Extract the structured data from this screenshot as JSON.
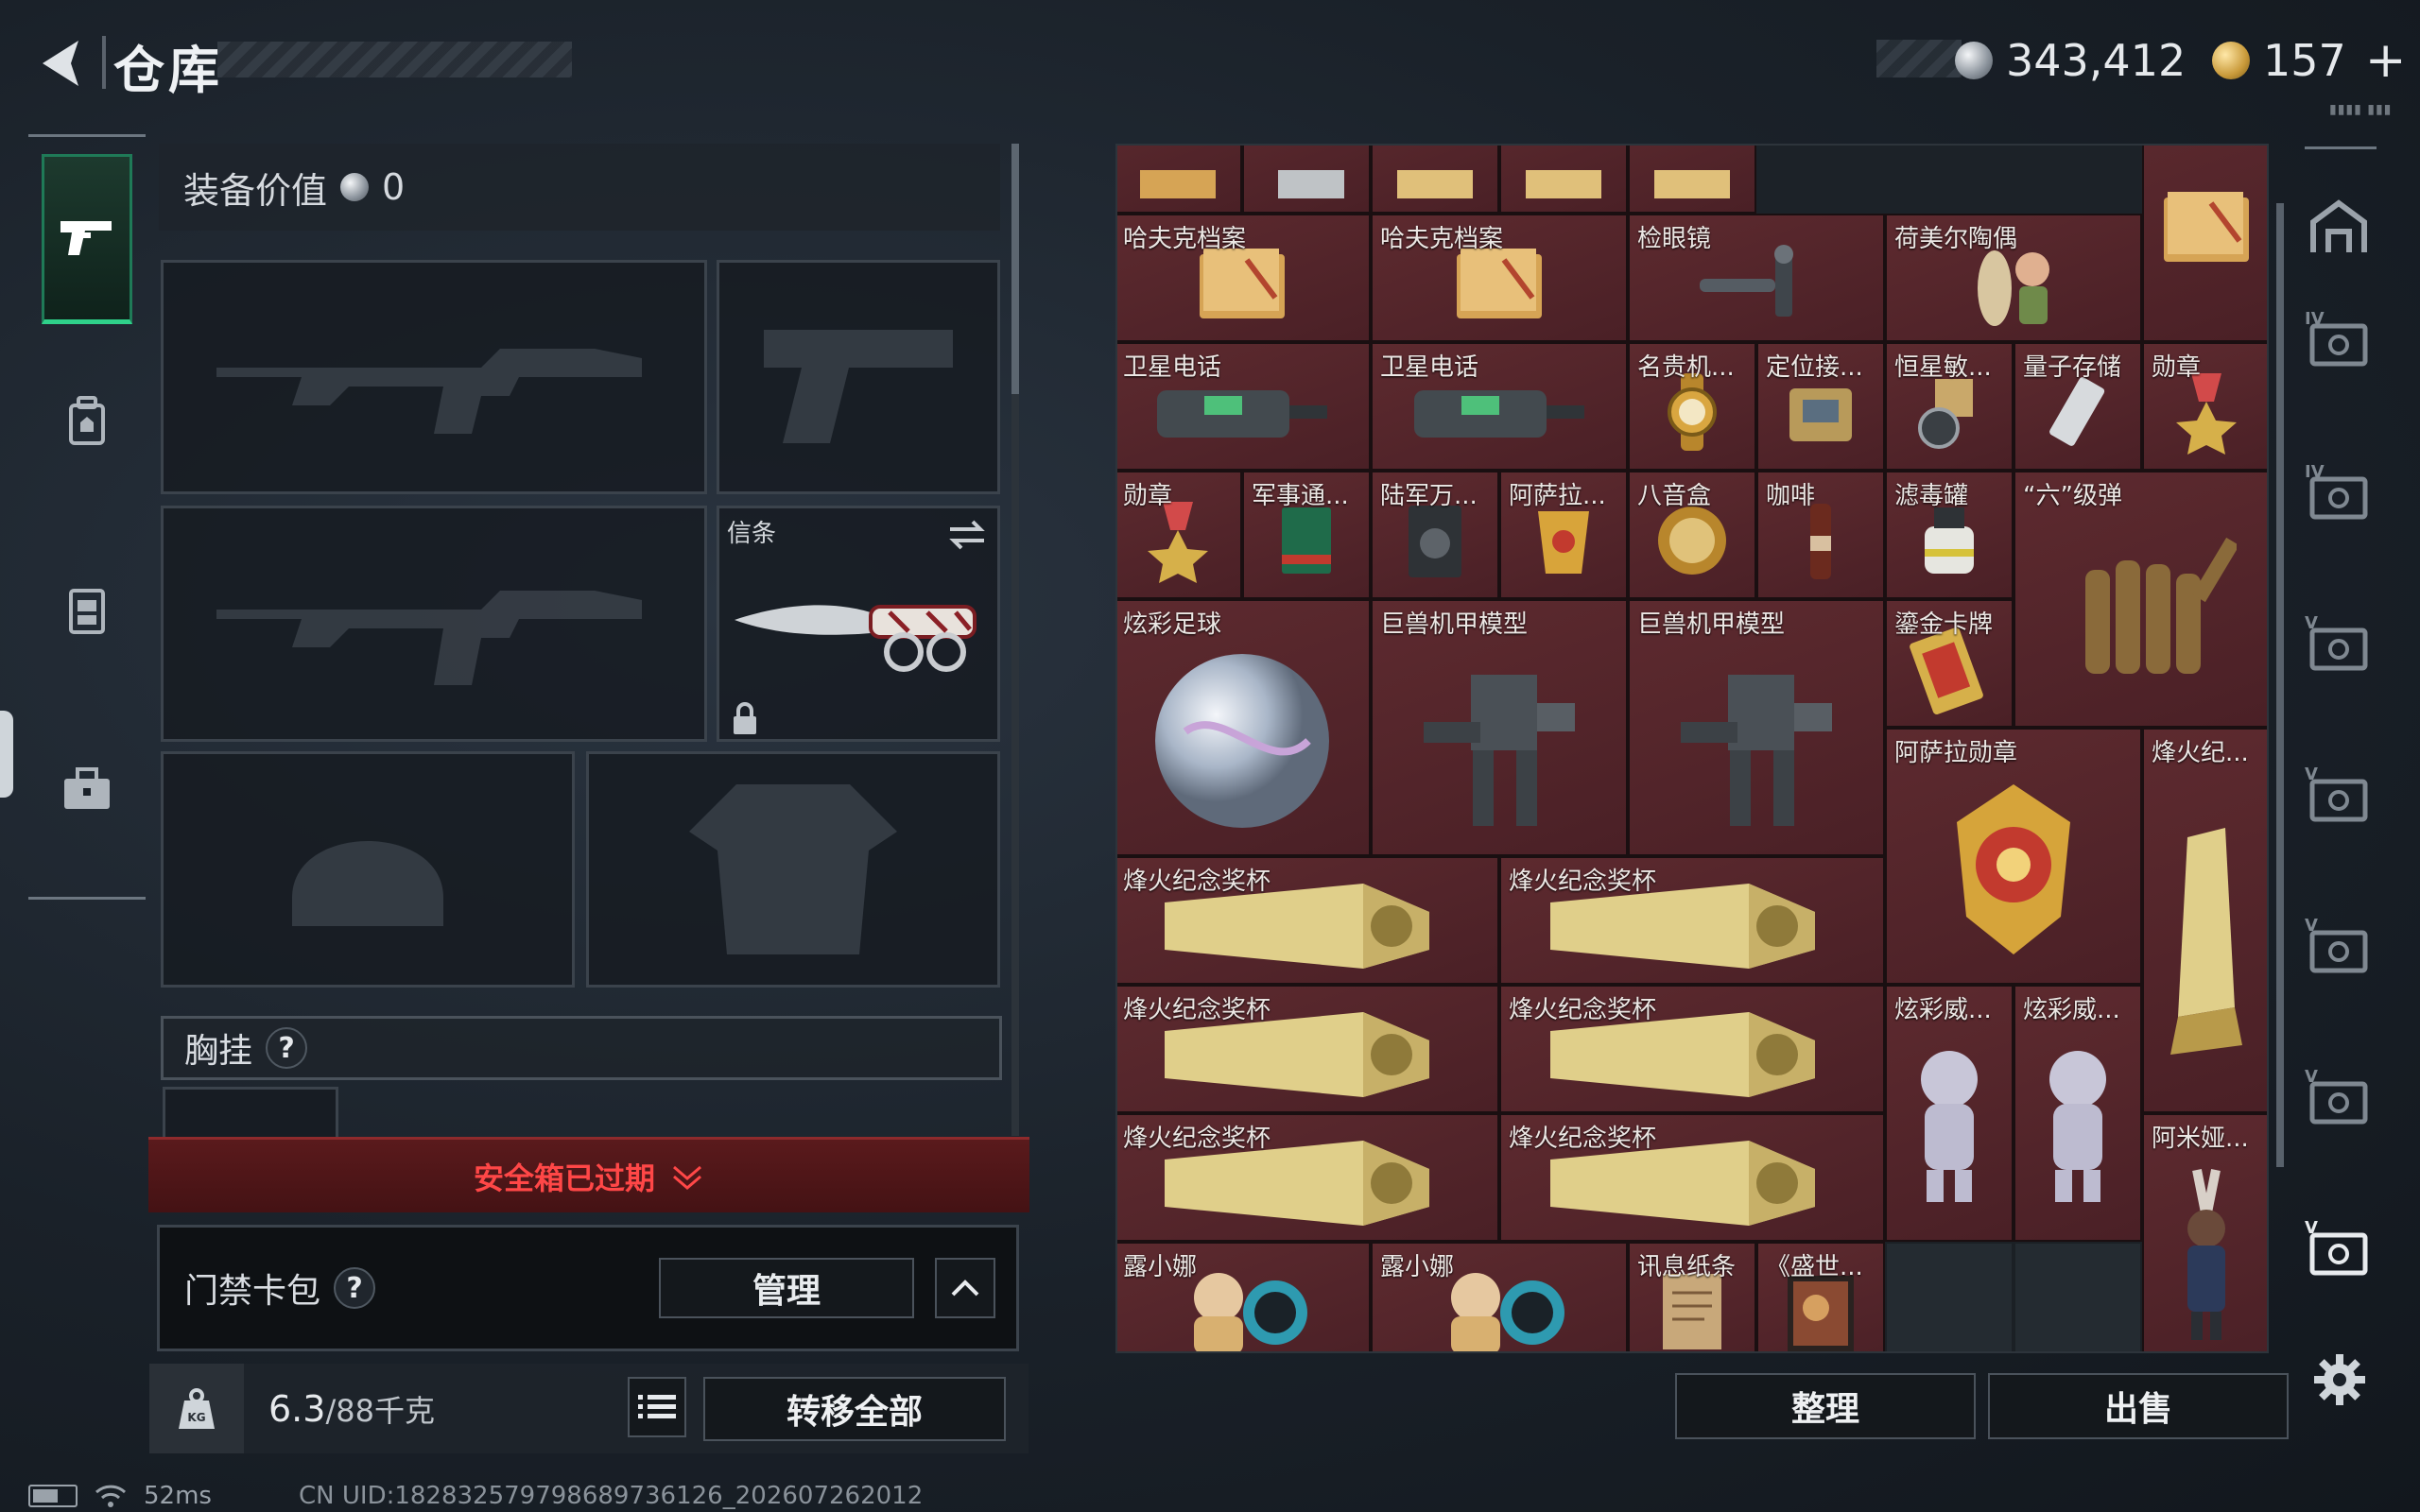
{
  "header": {
    "title": "仓库",
    "currency_silver": "343,412",
    "currency_gold": "157",
    "plus": "+",
    "watermark": "▮▮▮▮ ▮▮▮"
  },
  "side_tabs": [
    {
      "name": "weapons",
      "icon": "pistol-icon",
      "active": true
    },
    {
      "name": "backpack",
      "icon": "backpack-icon",
      "active": false
    },
    {
      "name": "vest",
      "icon": "vest-icon",
      "active": false
    },
    {
      "name": "toolbox",
      "icon": "toolbox-icon",
      "active": false
    }
  ],
  "equipment": {
    "value_label": "装备价值",
    "value": "0",
    "melee_label": "信条",
    "chest_label": "胸挂",
    "help": "?",
    "safe_box_expired": "安全箱已过期",
    "keycard_label": "门禁卡包",
    "manage_label": "管理",
    "weight_current": "6.3",
    "weight_max": "/88千克",
    "transfer_all_label": "转移全部"
  },
  "storage": {
    "items": [
      {
        "label": "",
        "art": "item-top-1"
      },
      {
        "label": "",
        "art": "item-top-2"
      },
      {
        "label": "",
        "art": "item-top-3"
      },
      {
        "label": "",
        "art": "item-top-4"
      },
      {
        "label": "",
        "art": "item-top-5"
      },
      {
        "label": "哈夫克档案",
        "art": "folder"
      },
      {
        "label": "哈夫克档案",
        "art": "folder"
      },
      {
        "label": "检眼镜",
        "art": "ophthalmoscope"
      },
      {
        "label": "荷美尔陶偶",
        "art": "figurine"
      },
      {
        "label": "",
        "art": "folder"
      },
      {
        "label": "卫星电话",
        "art": "satphone"
      },
      {
        "label": "卫星电话",
        "art": "satphone"
      },
      {
        "label": "名贵机...",
        "art": "watch"
      },
      {
        "label": "定位接...",
        "art": "receiver"
      },
      {
        "label": "恒星敏...",
        "art": "sensor"
      },
      {
        "label": "量子存储",
        "art": "drive"
      },
      {
        "label": "勋章",
        "art": "medal"
      },
      {
        "label": "勋章",
        "art": "medal"
      },
      {
        "label": "军事通...",
        "art": "book"
      },
      {
        "label": "陆军万...",
        "art": "radio"
      },
      {
        "label": "阿萨拉...",
        "art": "cup"
      },
      {
        "label": "八音盒",
        "art": "musicbox"
      },
      {
        "label": "咖啡",
        "art": "coffee"
      },
      {
        "label": "滤毒罐",
        "art": "canister"
      },
      {
        "label": "“六”级弹",
        "art": "bullets"
      },
      {
        "label": "炫彩足球",
        "art": "ball"
      },
      {
        "label": "巨兽机甲模型",
        "art": "mech"
      },
      {
        "label": "巨兽机甲模型",
        "art": "mech"
      },
      {
        "label": "鎏金卡牌",
        "art": "card"
      },
      {
        "label": "阿萨拉勋章",
        "art": "badge"
      },
      {
        "label": "烽火纪...",
        "art": "trophy-v"
      },
      {
        "label": "烽火纪念奖杯",
        "art": "trophy"
      },
      {
        "label": "烽火纪念奖杯",
        "art": "trophy"
      },
      {
        "label": "烽火纪念奖杯",
        "art": "trophy"
      },
      {
        "label": "烽火纪念奖杯",
        "art": "trophy"
      },
      {
        "label": "炫彩威...",
        "art": "bear"
      },
      {
        "label": "炫彩威...",
        "art": "bear"
      },
      {
        "label": "烽火纪念奖杯",
        "art": "trophy"
      },
      {
        "label": "烽火纪念奖杯",
        "art": "trophy"
      },
      {
        "label": "阿米娅...",
        "art": "amiya"
      },
      {
        "label": "露小娜",
        "art": "doll"
      },
      {
        "label": "露小娜",
        "art": "doll"
      },
      {
        "label": "讯息纸条",
        "art": "note"
      },
      {
        "label": "《盛世...",
        "art": "painting"
      }
    ],
    "sort_label": "整理",
    "sell_label": "出售"
  },
  "container_tabs": [
    "IV",
    "IV",
    "V",
    "V",
    "V",
    "V",
    "V"
  ],
  "status": {
    "ping": "52ms",
    "uid": "CN UID:1828325797986897361​26_202607262012"
  },
  "colors": {
    "accent_green": "#2fd18a",
    "alert_red": "#ff4747",
    "item_bg": "#5d2a2f"
  }
}
